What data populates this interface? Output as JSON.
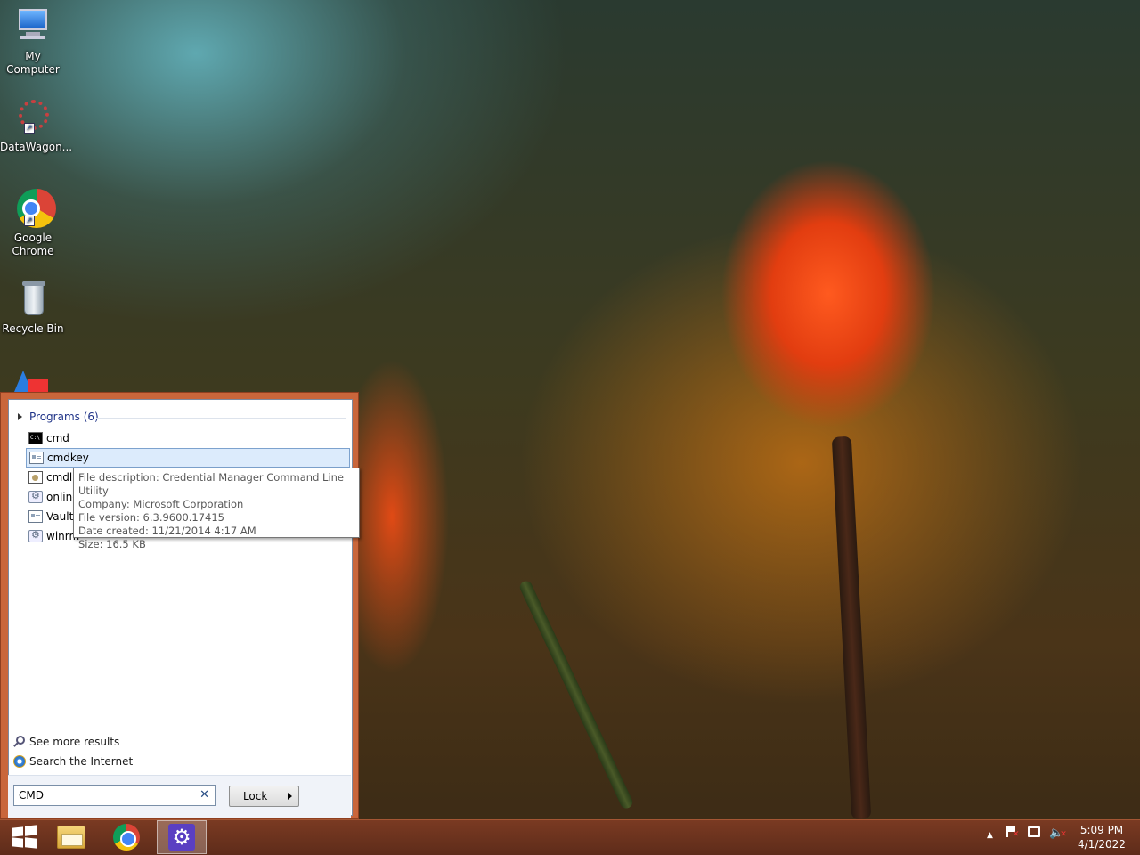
{
  "desktop": {
    "icons": [
      {
        "label_line1": "My",
        "label_line2": "Computer",
        "icon": "my-computer-icon"
      },
      {
        "label_line1": "DataWagon...",
        "label_line2": "",
        "icon": "datawagon-shortcut-icon"
      },
      {
        "label_line1": "Google",
        "label_line2": "Chrome",
        "icon": "chrome-shortcut-icon"
      },
      {
        "label_line1": "Recycle Bin",
        "label_line2": "",
        "icon": "recycle-bin-icon"
      }
    ]
  },
  "search_panel": {
    "group_label": "Programs (6)",
    "programs": [
      {
        "name": "cmd",
        "icon": "cmd-icon"
      },
      {
        "name": "cmdkey",
        "icon": "app-window-icon"
      },
      {
        "name": "cmdl32",
        "icon": "cert-icon"
      },
      {
        "name": "online",
        "icon": "gear-app-icon"
      },
      {
        "name": "VaultC",
        "icon": "app-window-icon"
      },
      {
        "name": "winrm",
        "icon": "gear-app-icon"
      }
    ],
    "tooltip": {
      "description": "File description: Credential Manager Command Line Utility",
      "company": "Company: Microsoft Corporation",
      "version": "File version: 6.3.9600.17415",
      "created": "Date created: 11/21/2014 4:17 AM",
      "size": "Size: 16.5 KB"
    },
    "see_more": "See more results",
    "search_internet": "Search the Internet",
    "search_value": "CMD",
    "lock_label": "Lock"
  },
  "taskbar": {
    "time": "5:09 PM",
    "date": "4/1/2022"
  },
  "colors": {
    "panel_border": "#c9663b",
    "taskbar": "#6a321e",
    "selection": "#dcebfc"
  }
}
